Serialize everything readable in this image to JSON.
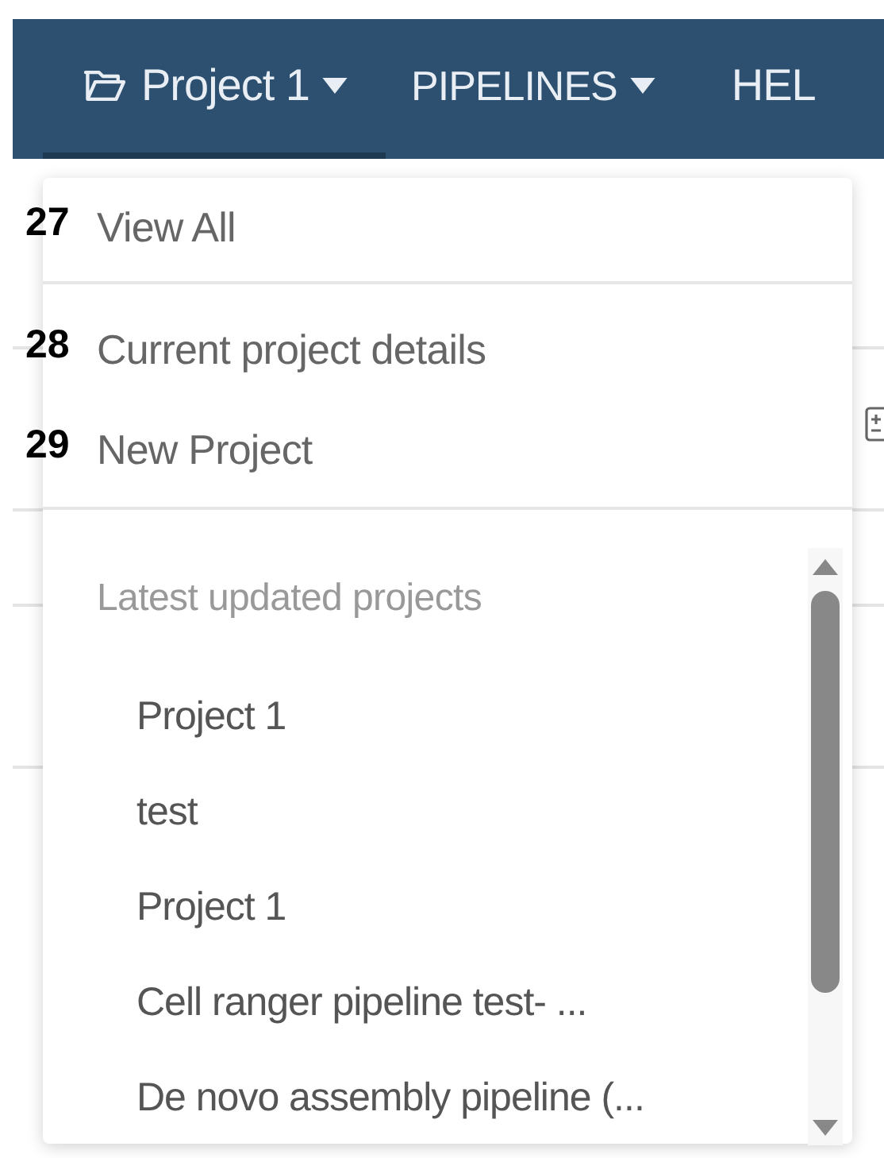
{
  "navbar": {
    "tabs": [
      {
        "label": "Project 1",
        "caret": true,
        "selected": true
      },
      {
        "label": "PIPELINES",
        "caret": true,
        "selected": false
      },
      {
        "label": "HEL",
        "caret": false,
        "selected": false
      }
    ]
  },
  "menu": {
    "groups": [
      [
        {
          "marker": "27",
          "label": "View All"
        }
      ],
      [
        {
          "marker": "28",
          "label": "Current project details"
        },
        {
          "marker": "29",
          "label": "New Project"
        }
      ]
    ],
    "section_title": "Latest updated projects",
    "projects": [
      "Project 1",
      "test",
      "Project 1",
      "Cell ranger pipeline test- ...",
      "De novo assembly pipeline (..."
    ]
  }
}
